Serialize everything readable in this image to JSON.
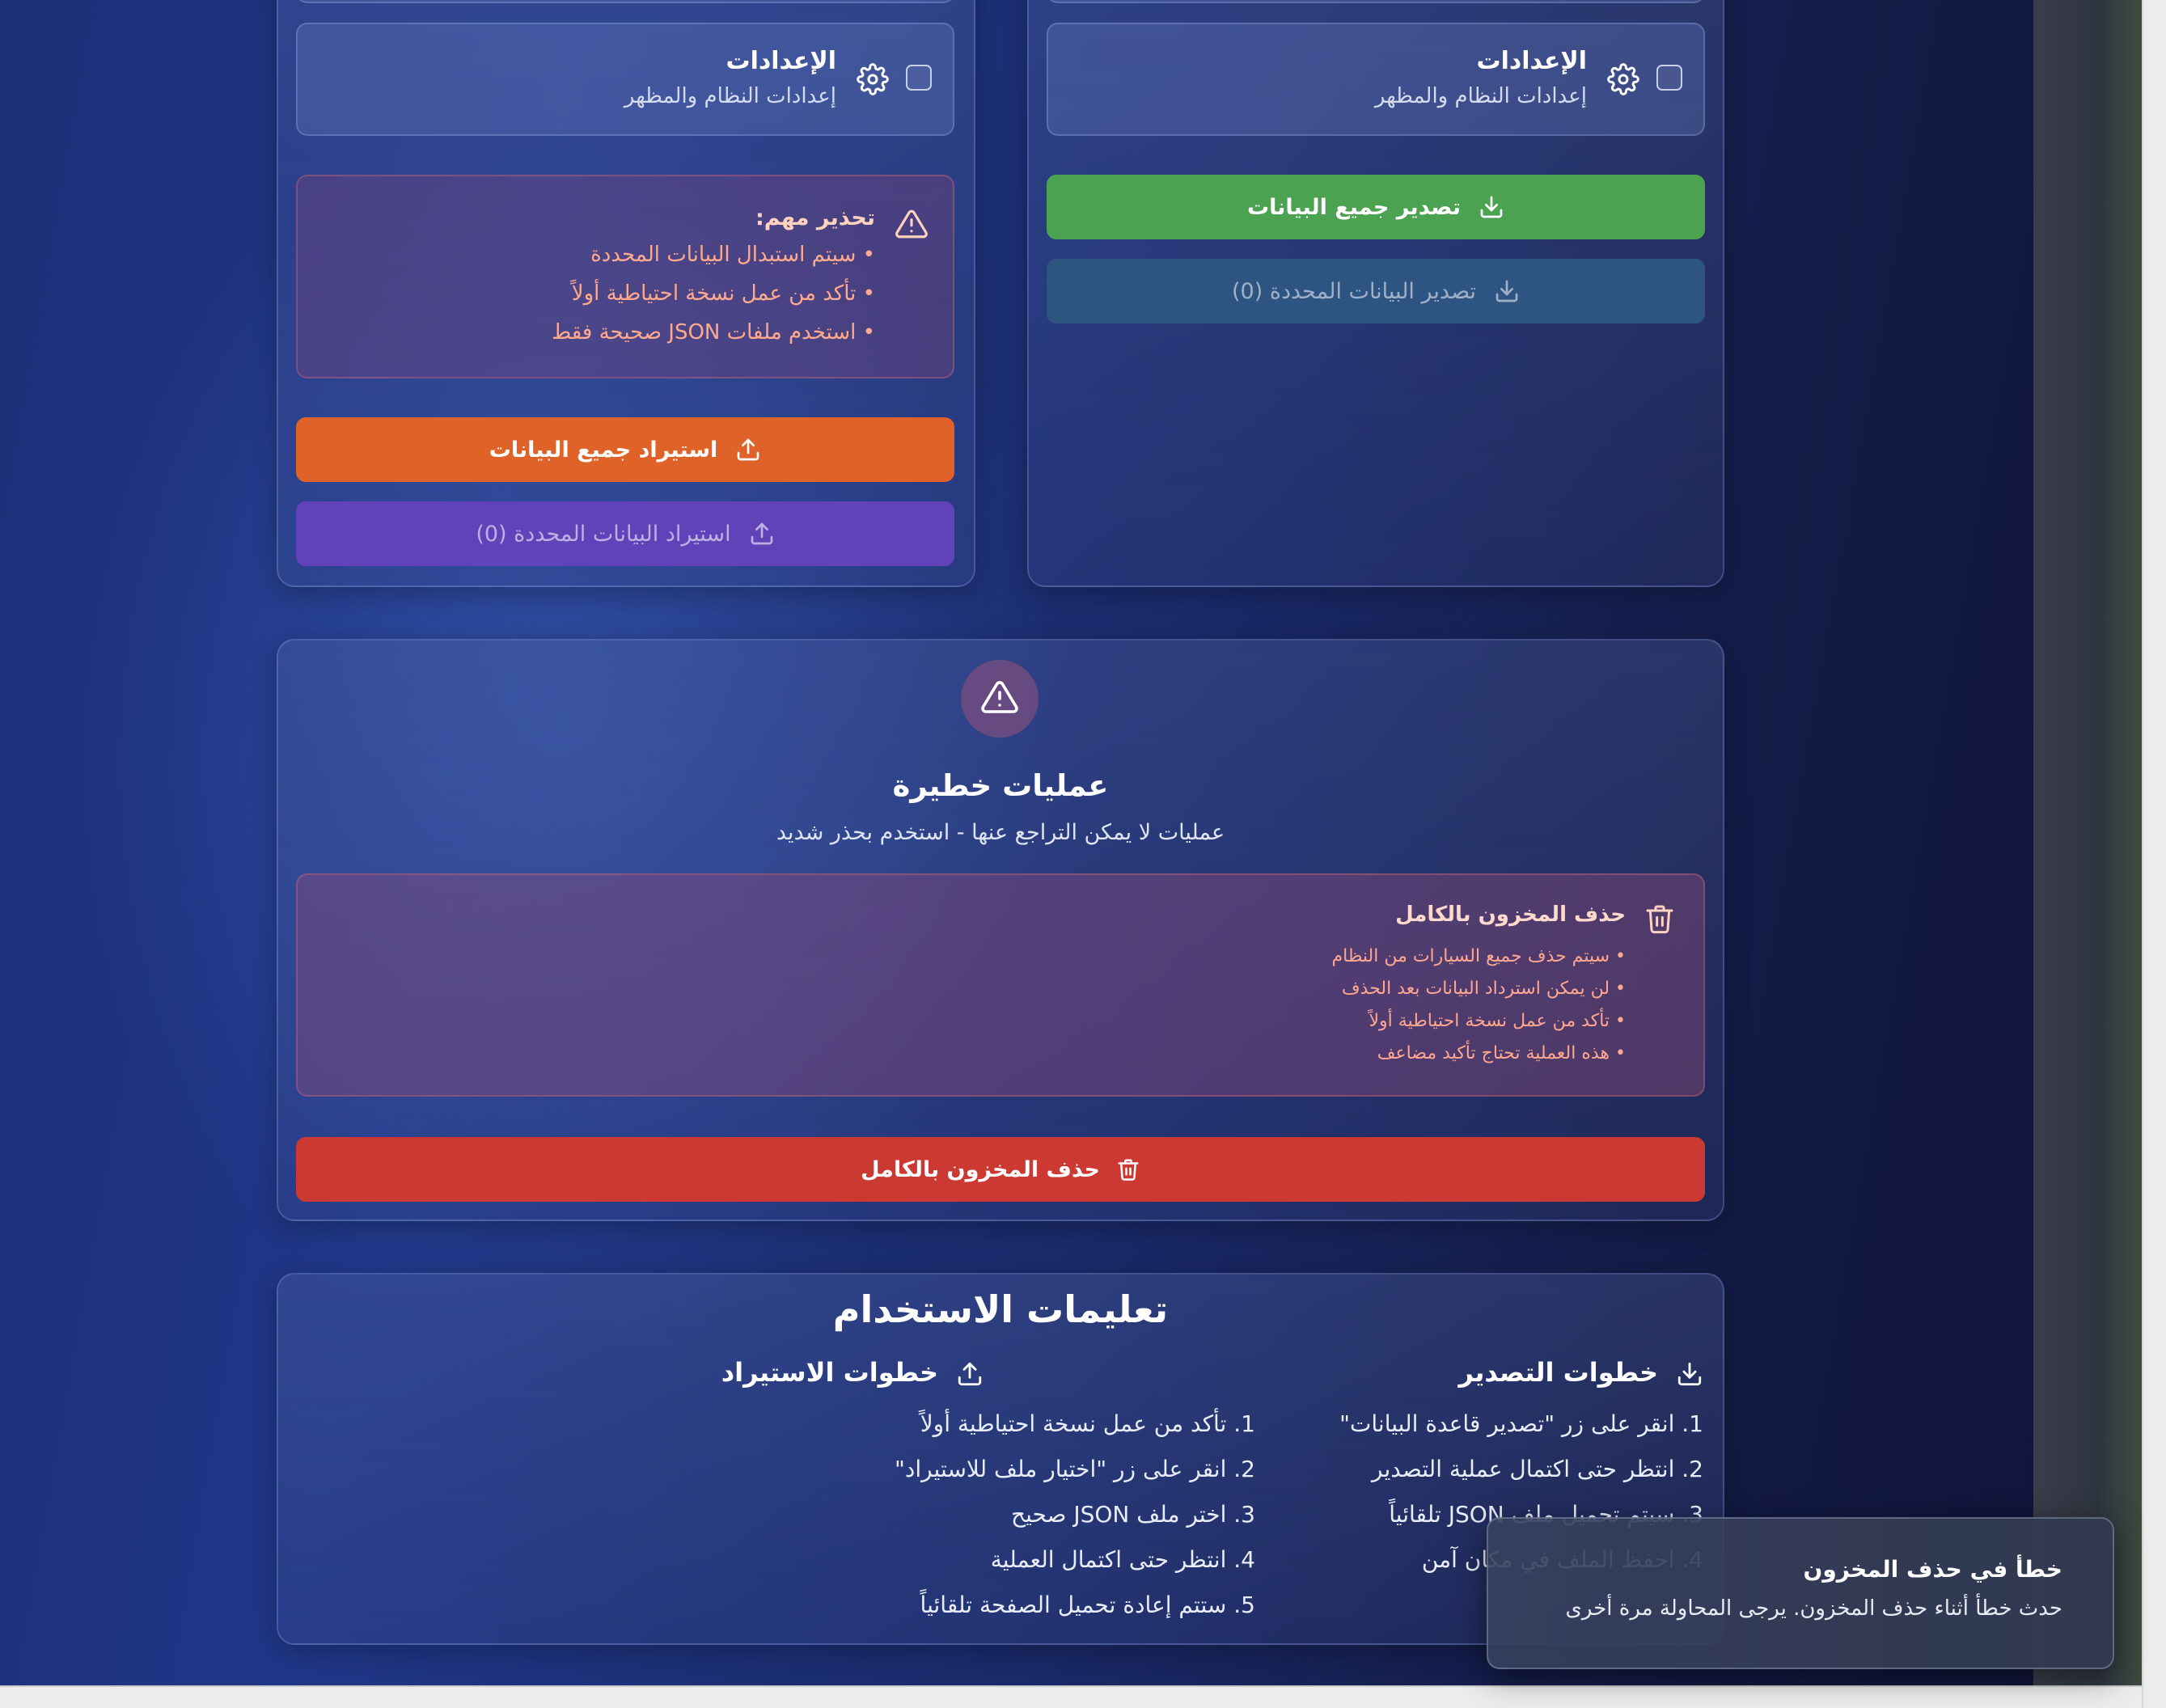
{
  "settings_item": {
    "title": "الإعدادات",
    "subtitle": "إعدادات النظام والمظهر",
    "icon": "gear-icon"
  },
  "import_panel": {
    "warning_title": "تحذير مهم:",
    "warning_items": [
      "• سيتم استبدال البيانات المحددة",
      "• تأكد من عمل نسخة احتياطية أولاً",
      "• استخدم ملفات JSON صحيحة فقط"
    ],
    "import_all_label": "استيراد جميع البيانات",
    "import_selected_label": "استيراد البيانات المحددة (0)"
  },
  "export_panel": {
    "export_all_label": "تصدير جميع البيانات",
    "export_selected_label": "تصدير البيانات المحددة (0)"
  },
  "danger_zone": {
    "title": "عمليات خطيرة",
    "subtitle": "عمليات لا يمكن التراجع عنها - استخدم بحذر شديد",
    "box_title": "حذف المخزون بالكامل",
    "box_items": [
      "• سيتم حذف جميع السيارات من النظام",
      "• لن يمكن استرداد البيانات بعد الحذف",
      "• تأكد من عمل نسخة احتياطية أولاً",
      "• هذه العملية تحتاج تأكيد مضاعف"
    ],
    "delete_button_label": "حذف المخزون بالكامل"
  },
  "instructions": {
    "title": "تعليمات الاستخدام",
    "export_heading": "خطوات التصدير",
    "export_steps": [
      "1. انقر على زر \"تصدير قاعدة البيانات\"",
      "2. انتظر حتى اكتمال عملية التصدير",
      "3. سيتم تحميل ملف JSON تلقائياً",
      "4. احفظ الملف في مكان آمن"
    ],
    "import_heading": "خطوات الاستيراد",
    "import_steps": [
      "1. تأكد من عمل نسخة احتياطية أولاً",
      "2. انقر على زر \"اختيار ملف للاستيراد\"",
      "3. اختر ملف JSON صحيح",
      "4. انتظر حتى اكتمال العملية",
      "5. ستتم إعادة تحميل الصفحة تلقائياً"
    ]
  },
  "toast": {
    "title": "خطأ في حذف المخزون",
    "message": "حدث خطأ أثناء حذف المخزون. يرجى المحاولة مرة أخرى"
  },
  "colors": {
    "export_all": "#4ba352",
    "export_selected": "#2e5582",
    "import_all": "#df6228",
    "import_selected": "#6142b8",
    "delete": "#cc3933",
    "warning_text": "#ffa98d"
  }
}
